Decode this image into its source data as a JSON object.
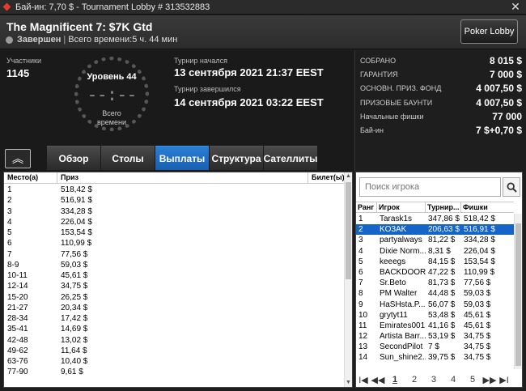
{
  "window": {
    "title": "Бай-ин: 7,70 $ - Tournament Lobby # 313532883",
    "close_glyph": "✕"
  },
  "header": {
    "tournament_name": "The Magnificent 7: $7K Gtd",
    "status": "Завершен",
    "separator": "|",
    "total_time": "Всего времени:5 ч. 44 мин",
    "poker_lobby_label": "Poker Lobby"
  },
  "info": {
    "participants_label": "Участники",
    "participants_value": "1145",
    "level": "Уровень 44",
    "clock_time": "--:--",
    "clock_total_label": "Всего\nвремени",
    "started_label": "Турнир начался",
    "started_value": "13 сентября 2021   21:37 EEST",
    "ended_label": "Турнир завершился",
    "ended_value": "14 сентября 2021   03:22 EEST"
  },
  "tabs": [
    {
      "label": "Обзор",
      "active": false
    },
    {
      "label": "Столы",
      "active": false
    },
    {
      "label": "Выплаты",
      "active": true
    },
    {
      "label": "Структура",
      "active": false
    },
    {
      "label": "Сателлиты",
      "active": false
    }
  ],
  "stats": [
    {
      "label": "СОБРАНО",
      "value": "8 015 $"
    },
    {
      "label": "ГАРАНТИЯ",
      "value": "7 000 $"
    },
    {
      "label": "ОСНОВН. ПРИЗ. ФОНД",
      "value": "4 007,50 $"
    },
    {
      "label": "ПРИЗОВЫЕ БАУНТИ",
      "value": "4 007,50 $"
    },
    {
      "label": "Начальные фишки",
      "value": "77 000"
    },
    {
      "label": "Бай-ин",
      "value": "7 $+0,70 $"
    }
  ],
  "payouts": {
    "columns": [
      "Место(а)",
      "Приз",
      "Билет(ы)"
    ],
    "rows": [
      {
        "place": "1",
        "prize": "518,42 $"
      },
      {
        "place": "2",
        "prize": "516,91 $"
      },
      {
        "place": "3",
        "prize": "334,28 $"
      },
      {
        "place": "4",
        "prize": "226,04 $"
      },
      {
        "place": "5",
        "prize": "153,54 $"
      },
      {
        "place": "6",
        "prize": "110,99 $"
      },
      {
        "place": "7",
        "prize": "77,56 $"
      },
      {
        "place": "8-9",
        "prize": "59,03 $"
      },
      {
        "place": "10-11",
        "prize": "45,61 $"
      },
      {
        "place": "12-14",
        "prize": "34,75 $"
      },
      {
        "place": "15-20",
        "prize": "26,25 $"
      },
      {
        "place": "21-27",
        "prize": "20,34 $"
      },
      {
        "place": "28-34",
        "prize": "17,42 $"
      },
      {
        "place": "35-41",
        "prize": "14,69 $"
      },
      {
        "place": "42-48",
        "prize": "13,02 $"
      },
      {
        "place": "49-62",
        "prize": "11,64 $"
      },
      {
        "place": "63-76",
        "prize": "10,40 $"
      },
      {
        "place": "77-90",
        "prize": "9,61 $"
      }
    ]
  },
  "players": {
    "search_placeholder": "Поиск игрока",
    "columns": [
      "Ранг",
      "Игрок",
      "Турнир...",
      "Фишки"
    ],
    "rows": [
      {
        "rank": "1",
        "player": "Tarask1s",
        "tour": "347,86 $",
        "chips": "518,42 $",
        "selected": false
      },
      {
        "rank": "2",
        "player": "KO3AK",
        "tour": "206,63 $",
        "chips": "516,91 $",
        "selected": true
      },
      {
        "rank": "3",
        "player": "partyalways",
        "tour": "81,22 $",
        "chips": "334,28 $",
        "selected": false
      },
      {
        "rank": "4",
        "player": "Dixie Norm...",
        "tour": "8,31 $",
        "chips": "226,04 $",
        "selected": false
      },
      {
        "rank": "5",
        "player": "keeegs",
        "tour": "84,15 $",
        "chips": "153,54 $",
        "selected": false
      },
      {
        "rank": "6",
        "player": "BACKDOOR...",
        "tour": "47,22 $",
        "chips": "110,99 $",
        "selected": false
      },
      {
        "rank": "7",
        "player": "Sr.Beto",
        "tour": "81,73 $",
        "chips": "77,56 $",
        "selected": false
      },
      {
        "rank": "8",
        "player": "PM Walter",
        "tour": "44,48 $",
        "chips": "59,03 $",
        "selected": false
      },
      {
        "rank": "9",
        "player": "HaSHsta.P...",
        "tour": "56,07 $",
        "chips": "59,03 $",
        "selected": false
      },
      {
        "rank": "10",
        "player": "grytyt11",
        "tour": "53,48 $",
        "chips": "45,61 $",
        "selected": false
      },
      {
        "rank": "11",
        "player": "Emirates001",
        "tour": "41,16 $",
        "chips": "45,61 $",
        "selected": false
      },
      {
        "rank": "12",
        "player": "Artista Barr...",
        "tour": "53,19 $",
        "chips": "34,75 $",
        "selected": false
      },
      {
        "rank": "13",
        "player": "SecondPilot",
        "tour": "7 $",
        "chips": "34,75 $",
        "selected": false
      },
      {
        "rank": "14",
        "player": "Sun_shine2...",
        "tour": "39,75 $",
        "chips": "34,75 $",
        "selected": false
      }
    ],
    "pager": {
      "first": "I◀",
      "prev": "◀◀",
      "pages": [
        "1",
        "2",
        "3",
        "4",
        "5"
      ],
      "current": "1",
      "next": "▶▶",
      "last": "▶I"
    }
  }
}
